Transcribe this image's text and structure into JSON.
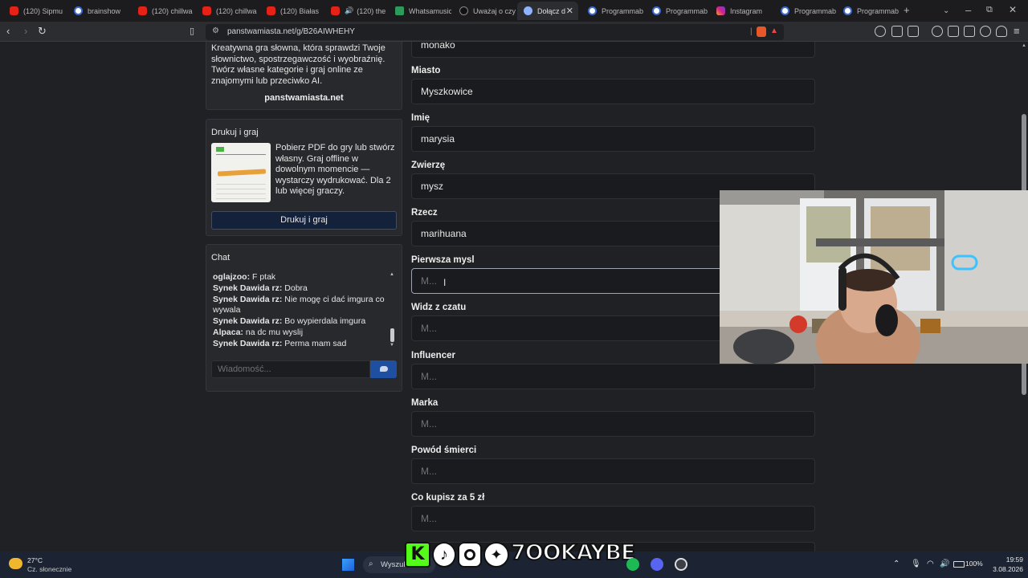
{
  "browser": {
    "tabs": [
      {
        "title": "(120) Sipmu",
        "icon": "youtube"
      },
      {
        "title": "brainshow",
        "icon": "globe"
      },
      {
        "title": "(120) chillwa",
        "icon": "youtube"
      },
      {
        "title": "(120) chillwa",
        "icon": "youtube"
      },
      {
        "title": "(120) Białas",
        "icon": "youtube"
      },
      {
        "title": "(120) the",
        "icon": "youtube"
      },
      {
        "title": "Whatsamusic",
        "icon": "whatsamusic"
      },
      {
        "title": "Uważaj o czy",
        "icon": "tiktok"
      },
      {
        "title": "Dołącz d",
        "icon": "panstwa"
      },
      {
        "title": "Programmab",
        "icon": "globe"
      },
      {
        "title": "Programmab",
        "icon": "globe"
      },
      {
        "title": "Instagram",
        "icon": "instagram"
      },
      {
        "title": "Programmab",
        "icon": "globe"
      },
      {
        "title": "Programmab",
        "icon": "globe"
      }
    ],
    "url": "panstwamiasta.net/g/B26AIWHEHY"
  },
  "sidebar": {
    "about_text": "Kreatywna gra słowna, która sprawdzi Twoje słownictwo, spostrzegawczość i wyobraźnię. Twórz własne kategorie i graj online ze znajomymi lub przeciwko AI.",
    "about_link": "panstwamiasta.net",
    "print": {
      "title": "Drukuj i graj",
      "text": "Pobierz PDF do gry lub stwórz własny. Graj offline w dowolnym momencie — wystarczy wydrukować. Dla 2 lub więcej graczy.",
      "button": "Drukuj i graj"
    },
    "chat": {
      "title": "Chat",
      "messages": [
        {
          "user": "",
          "text": "."
        },
        {
          "user": "oglajzoo:",
          "text": "F ptak"
        },
        {
          "user": "Synek Dawida rz:",
          "text": "Dobra"
        },
        {
          "user": "Synek Dawida rz:",
          "text": "Nie mogę ci dać imgura co wywala"
        },
        {
          "user": "Synek Dawida rz:",
          "text": "Bo wypierdala imgura"
        },
        {
          "user": "Alpaca:",
          "text": "na dc mu wyslij"
        },
        {
          "user": "Synek Dawida rz:",
          "text": "Perma mam sad"
        }
      ],
      "input_placeholder": "Wiadomość..."
    }
  },
  "form": {
    "fields": [
      {
        "label": "",
        "value": "monako",
        "placeholder": ""
      },
      {
        "label": "Miasto",
        "value": "Myszkowice",
        "placeholder": ""
      },
      {
        "label": "Imię",
        "value": "marysia",
        "placeholder": ""
      },
      {
        "label": "Zwierzę",
        "value": "mysz",
        "placeholder": ""
      },
      {
        "label": "Rzecz",
        "value": "marihuana",
        "placeholder": ""
      },
      {
        "label": "Pierwsza mysl",
        "value": "",
        "placeholder": "M..."
      },
      {
        "label": "Widz z czatu",
        "value": "",
        "placeholder": "M..."
      },
      {
        "label": "Influencer",
        "value": "",
        "placeholder": "M..."
      },
      {
        "label": "Marka",
        "value": "",
        "placeholder": "M..."
      },
      {
        "label": "Powód śmierci",
        "value": "",
        "placeholder": "M..."
      },
      {
        "label": "Co kupisz za 5 zł",
        "value": "",
        "placeholder": "M..."
      }
    ]
  },
  "overlay": {
    "social_handle": "7OOKAYBE"
  },
  "taskbar": {
    "weather_temp": "27°C",
    "weather_desc": "Cz. słonecznie",
    "search_placeholder": "Wyszuk",
    "battery": "100%",
    "time": "19:59",
    "date": "3.08.2026"
  },
  "colors": {
    "page_bg": "#1f2124",
    "card_bg": "#27292d",
    "input_bg": "#1a1b1e",
    "accent_button": "#1e4fa0",
    "taskbar_bg": "#1c2433"
  }
}
